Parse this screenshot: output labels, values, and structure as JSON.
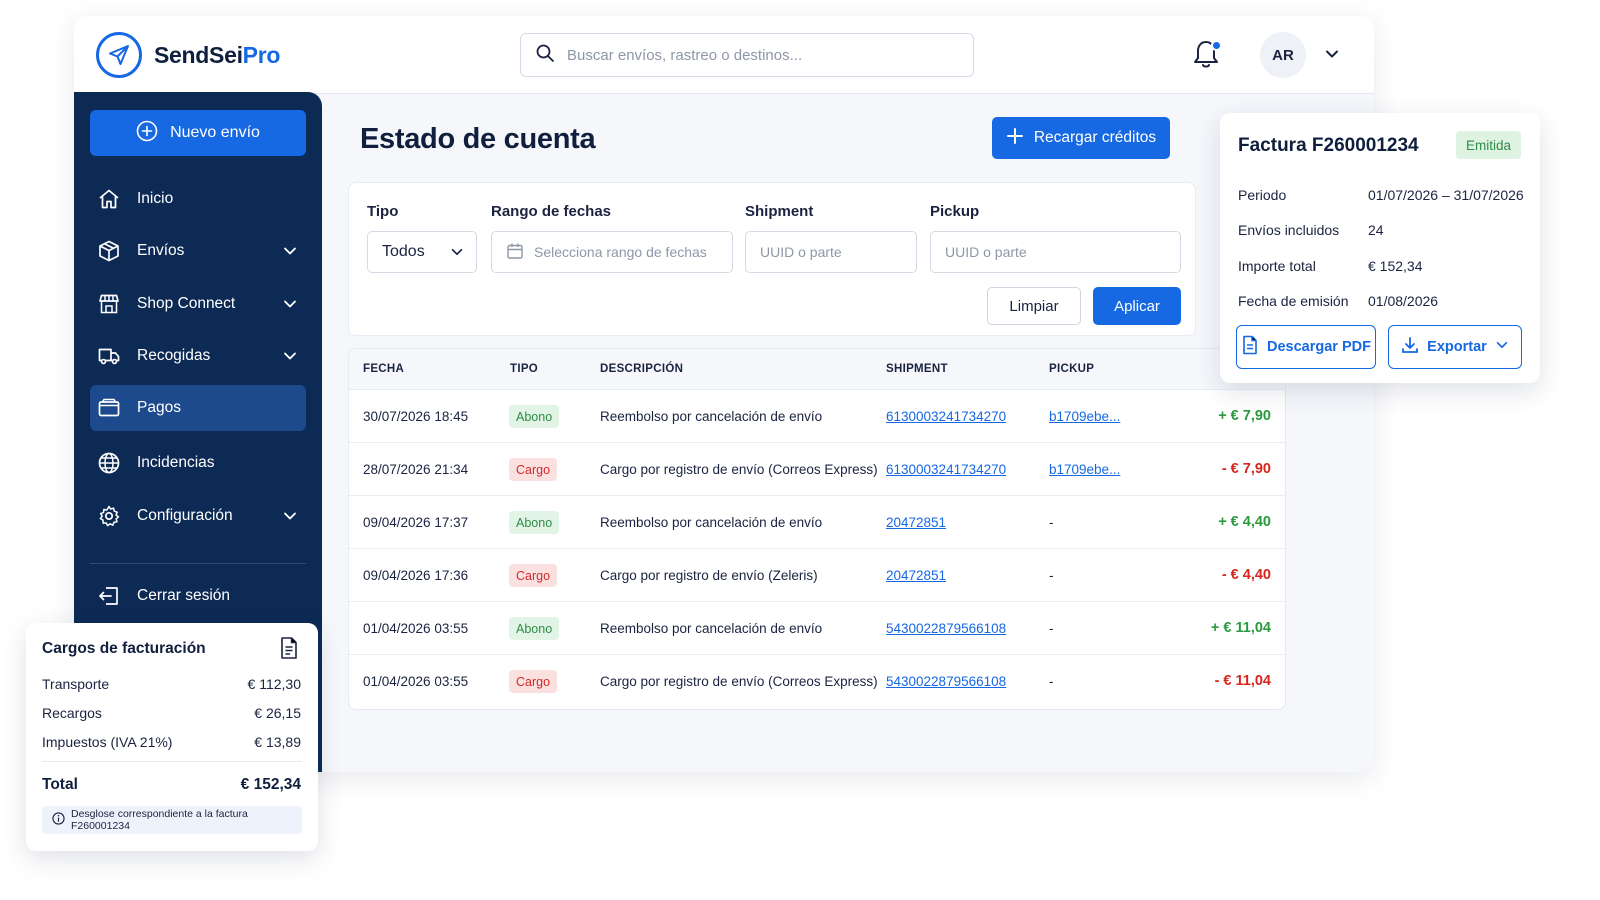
{
  "brand": {
    "name_part1": "SendSei",
    "name_part2": "Pro"
  },
  "colors": {
    "primary": "#1668e3",
    "sidebar": "#0d2a55",
    "sidebar_active": "#1c4a8c",
    "positive": "#2a9a3e",
    "negative": "#d9261c"
  },
  "search": {
    "placeholder": "Buscar envíos, rastreo o destinos..."
  },
  "user": {
    "initials": "AR"
  },
  "sidebar": {
    "new_button": "Nuevo envío",
    "items": [
      {
        "label": "Inicio",
        "icon": "home-icon"
      },
      {
        "label": "Envíos",
        "icon": "package-icon",
        "has_submenu": true
      },
      {
        "label": "Shop Connect",
        "icon": "store-icon",
        "has_submenu": true
      },
      {
        "label": "Recogidas",
        "icon": "truck-icon",
        "has_submenu": true
      },
      {
        "label": "Pagos",
        "icon": "wallet-icon",
        "active": true
      },
      {
        "label": "Incidencias",
        "icon": "globe-icon"
      },
      {
        "label": "Configuración",
        "icon": "gear-icon",
        "has_submenu": true
      }
    ],
    "logout": "Cerrar sesión"
  },
  "page": {
    "title": "Estado de cuenta",
    "recharge_button": "Recargar créditos"
  },
  "filters": {
    "tipo_label": "Tipo",
    "tipo_value": "Todos",
    "rango_label": "Rango de fechas",
    "rango_placeholder": "Selecciona rango de fechas",
    "shipment_label": "Shipment",
    "shipment_placeholder": "UUID o parte",
    "pickup_label": "Pickup",
    "pickup_placeholder": "UUID o parte",
    "clear_button": "Limpiar",
    "apply_button": "Aplicar"
  },
  "table": {
    "headers": {
      "fecha": "FECHA",
      "tipo": "TIPO",
      "descripcion": "DESCRIPCIÓN",
      "shipment": "SHIPMENT",
      "pickup": "PICKUP"
    },
    "rows": [
      {
        "fecha": "30/07/2026 18:45",
        "tipo": "Abono",
        "descripcion": "Reembolso por cancelación de envío",
        "shipment": "6130003241734270",
        "pickup": "b1709ebe...",
        "importe": "+ € 7,90"
      },
      {
        "fecha": "28/07/2026 21:34",
        "tipo": "Cargo",
        "descripcion": "Cargo por registro de envío (Correos Express)",
        "shipment": "6130003241734270",
        "pickup": "b1709ebe...",
        "importe": "- € 7,90"
      },
      {
        "fecha": "09/04/2026 17:37",
        "tipo": "Abono",
        "descripcion": "Reembolso por cancelación de envío",
        "shipment": "20472851",
        "pickup": "-",
        "importe": "+ € 4,40"
      },
      {
        "fecha": "09/04/2026 17:36",
        "tipo": "Cargo",
        "descripcion": "Cargo por registro de envío (Zeleris)",
        "shipment": "20472851",
        "pickup": "-",
        "importe": "- € 4,40"
      },
      {
        "fecha": "01/04/2026 03:55",
        "tipo": "Abono",
        "descripcion": "Reembolso por cancelación de envío",
        "shipment": "5430022879566108",
        "pickup": "-",
        "importe": "+ € 11,04"
      },
      {
        "fecha": "01/04/2026 03:55",
        "tipo": "Cargo",
        "descripcion": "Cargo por registro de envío (Correos Express)",
        "shipment": "5430022879566108",
        "pickup": "-",
        "importe": "- € 11,04"
      }
    ]
  },
  "invoice": {
    "title": "Factura F260001234",
    "status": "Emitida",
    "rows": [
      {
        "label": "Periodo",
        "value": "01/07/2026 – 31/07/2026"
      },
      {
        "label": "Envíos incluidos",
        "value": "24"
      },
      {
        "label": "Importe total",
        "value": "€ 152,34"
      },
      {
        "label": "Fecha de emisión",
        "value": "01/08/2026"
      }
    ],
    "download_button": "Descargar PDF",
    "export_button": "Exportar"
  },
  "billing": {
    "title": "Cargos de facturación",
    "rows": [
      {
        "label": "Transporte",
        "value": "€ 112,30"
      },
      {
        "label": "Recargos",
        "value": "€ 26,15"
      },
      {
        "label": "Impuestos (IVA 21%)",
        "value": "€ 13,89"
      }
    ],
    "total_label": "Total",
    "total_value": "€ 152,34",
    "note": "Desglose correspondiente a la factura F260001234"
  }
}
